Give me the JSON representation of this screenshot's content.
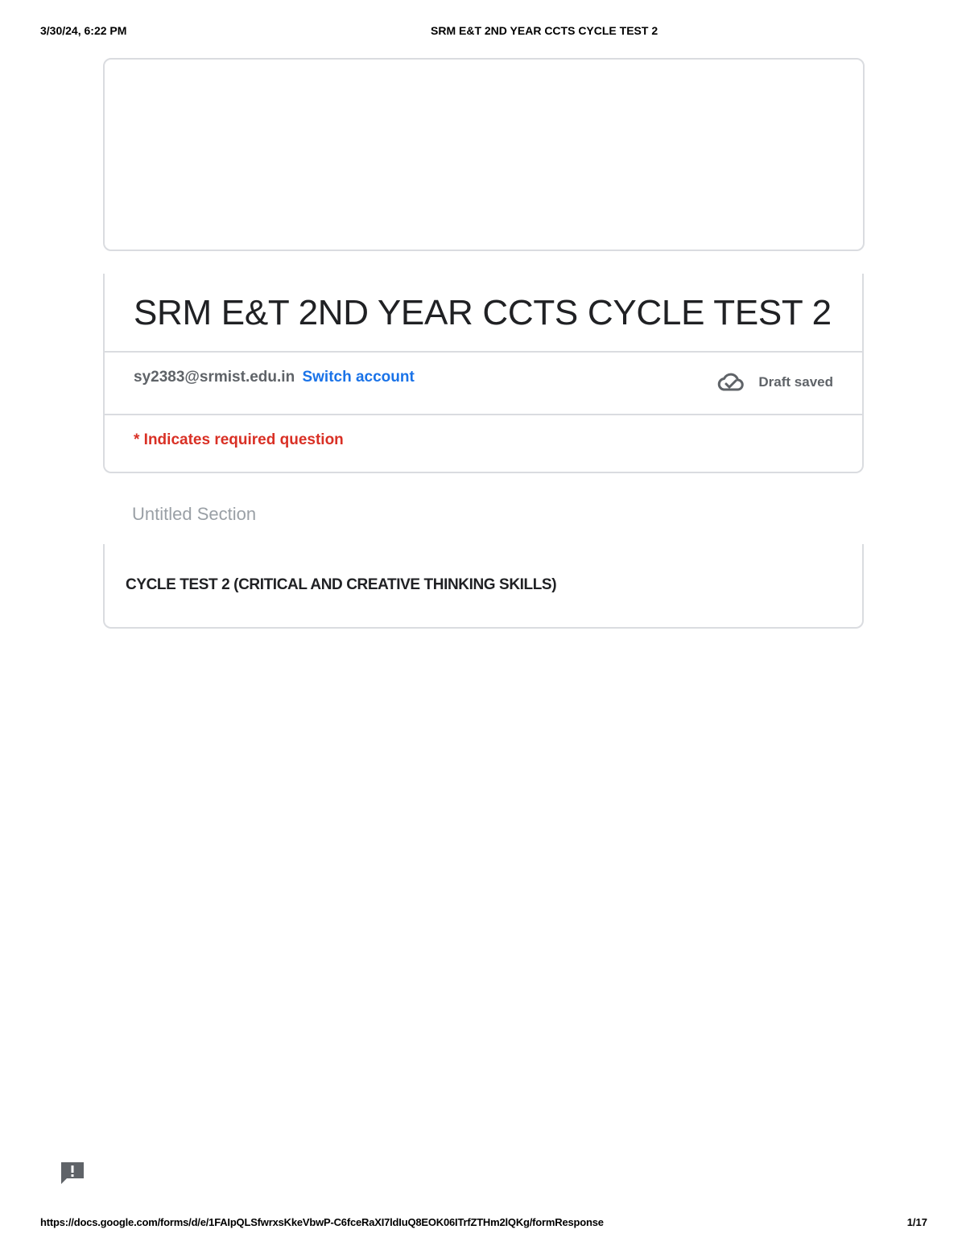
{
  "print_header": {
    "datetime": "3/30/24, 6:22 PM",
    "doc_title": "SRM E&T 2ND YEAR CCTS CYCLE TEST 2"
  },
  "form": {
    "title": "SRM E&T 2ND YEAR CCTS CYCLE TEST 2",
    "account_email": "sy2383@srmist.edu.in",
    "switch_account_label": "Switch account",
    "draft_status": "Draft saved",
    "required_note": "* Indicates required question",
    "section_title": "Untitled Section",
    "section_description": "CYCLE TEST 2 (CRITICAL AND CREATIVE THINKING SKILLS)"
  },
  "icons": {
    "draft": "cloud-done-icon",
    "feedback": "feedback-icon"
  },
  "colors": {
    "link": "#1a73e8",
    "required": "#d93025",
    "muted": "#5f6368",
    "border": "#dadce0"
  },
  "print_footer": {
    "url": "https://docs.google.com/forms/d/e/1FAIpQLSfwrxsKkeVbwP-C6fceRaXI7ldIuQ8EOK06ITrfZTHm2lQKg/formResponse",
    "page_number": "1/17"
  }
}
